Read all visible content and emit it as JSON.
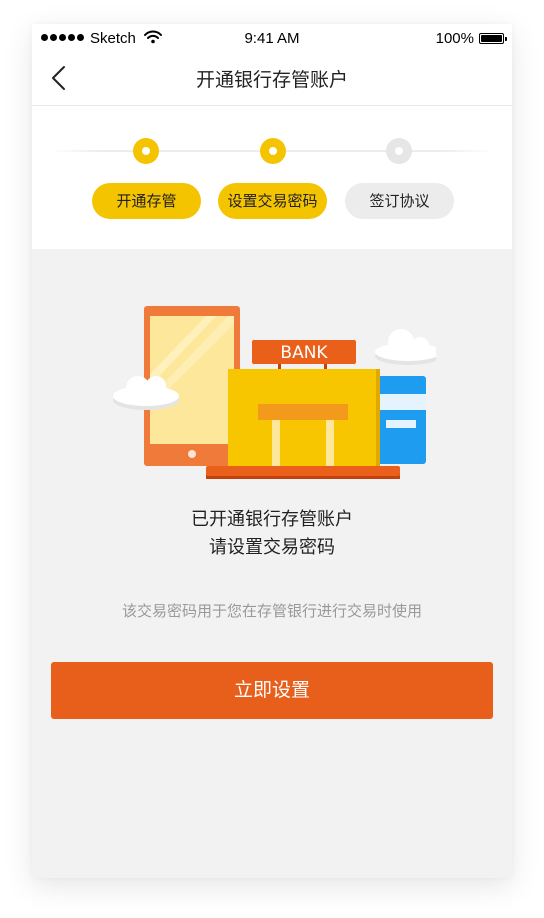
{
  "status_bar": {
    "carrier": "Sketch",
    "time": "9:41 AM",
    "battery": "100%"
  },
  "nav": {
    "title": "开通银行存管账户",
    "back_icon": "chevron-left-icon"
  },
  "steps": [
    {
      "label": "开通存管",
      "state": "done"
    },
    {
      "label": "设置交易密码",
      "state": "current"
    },
    {
      "label": "签订协议",
      "state": "pending"
    }
  ],
  "illustration": {
    "bank_sign": "BANK"
  },
  "message": {
    "line1": "已开通银行存管账户",
    "line2": "请设置交易密码"
  },
  "hint": "该交易密码用于您在存管银行进行交易时使用",
  "primary_button": "立即设置",
  "colors": {
    "accent_yellow": "#f5c400",
    "primary_orange": "#e85f1c",
    "inactive_gray": "#ececec",
    "background": "#f2f2f2"
  }
}
